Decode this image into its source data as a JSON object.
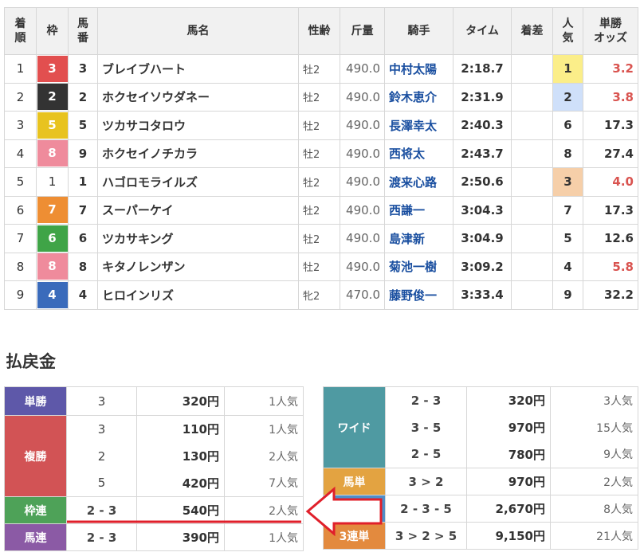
{
  "results": {
    "headers": [
      "着順",
      "枠",
      "馬番",
      "馬名",
      "性齢",
      "斤量",
      "騎手",
      "タイム",
      "着差",
      "人気",
      "単勝オッズ"
    ],
    "header_lines": [
      [
        "着",
        "順"
      ],
      [
        "枠"
      ],
      [
        "馬",
        "番"
      ],
      [
        "馬名"
      ],
      [
        "性齢"
      ],
      [
        "斤量"
      ],
      [
        "騎手"
      ],
      [
        "タイム"
      ],
      [
        "着差"
      ],
      [
        "人",
        "気"
      ],
      [
        "単勝",
        "オッズ"
      ]
    ],
    "rows": [
      {
        "rank": "1",
        "waku": "3",
        "waku_color": "#e24f4f",
        "umaban": "3",
        "name": "ブレイブハート",
        "sexage": "牡2",
        "weight": "490.0",
        "jockey": "中村太陽",
        "time": "2:18.7",
        "margin": "",
        "pop": "1",
        "odds": "3.2"
      },
      {
        "rank": "2",
        "waku": "2",
        "waku_color": "#333333",
        "umaban": "2",
        "name": "ホクセイソウダネー",
        "sexage": "牡2",
        "weight": "490.0",
        "jockey": "鈴木恵介",
        "time": "2:31.9",
        "margin": "",
        "pop": "2",
        "odds": "3.8"
      },
      {
        "rank": "3",
        "waku": "5",
        "waku_color": "#e8c31f",
        "umaban": "5",
        "name": "ツカサコタロウ",
        "sexage": "牡2",
        "weight": "490.0",
        "jockey": "長澤幸太",
        "time": "2:40.3",
        "margin": "",
        "pop": "6",
        "odds": "17.3"
      },
      {
        "rank": "4",
        "waku": "8",
        "waku_color": "#ef8b9c",
        "umaban": "9",
        "name": "ホクセイノチカラ",
        "sexage": "牡2",
        "weight": "490.0",
        "jockey": "西将太",
        "time": "2:43.7",
        "margin": "",
        "pop": "8",
        "odds": "27.4"
      },
      {
        "rank": "5",
        "waku": "1",
        "waku_color": "#ffffff",
        "umaban": "1",
        "name": "ハゴロモライルズ",
        "sexage": "牡2",
        "weight": "490.0",
        "jockey": "渡来心路",
        "time": "2:50.6",
        "margin": "",
        "pop": "3",
        "odds": "4.0"
      },
      {
        "rank": "6",
        "waku": "7",
        "waku_color": "#ee8e33",
        "umaban": "7",
        "name": "スーパーケイ",
        "sexage": "牡2",
        "weight": "490.0",
        "jockey": "西謙一",
        "time": "3:04.3",
        "margin": "",
        "pop": "7",
        "odds": "17.3"
      },
      {
        "rank": "7",
        "waku": "6",
        "waku_color": "#3fa447",
        "umaban": "6",
        "name": "ツカサキング",
        "sexage": "牡2",
        "weight": "490.0",
        "jockey": "島津新",
        "time": "3:04.9",
        "margin": "",
        "pop": "5",
        "odds": "12.6"
      },
      {
        "rank": "8",
        "waku": "8",
        "waku_color": "#ef8b9c",
        "umaban": "8",
        "name": "キタノレンザン",
        "sexage": "牡2",
        "weight": "490.0",
        "jockey": "菊池一樹",
        "time": "3:09.2",
        "margin": "",
        "pop": "4",
        "odds": "5.8"
      },
      {
        "rank": "9",
        "waku": "4",
        "waku_color": "#3a6bbb",
        "umaban": "4",
        "name": "ヒロインリズ",
        "sexage": "牝2",
        "weight": "470.0",
        "jockey": "藤野俊一",
        "time": "3:33.4",
        "margin": "",
        "pop": "9",
        "odds": "32.2"
      }
    ]
  },
  "payout": {
    "heading": "払戻金",
    "left": {
      "tansho": {
        "label": "単勝",
        "combo": "3",
        "yen": "320円",
        "pop": "1人気"
      },
      "fukusho": {
        "label": "複勝",
        "rows": [
          {
            "combo": "3",
            "yen": "110円",
            "pop": "1人気"
          },
          {
            "combo": "2",
            "yen": "130円",
            "pop": "2人気"
          },
          {
            "combo": "5",
            "yen": "420円",
            "pop": "7人気"
          }
        ]
      },
      "wakuren": {
        "label": "枠連",
        "combo": "2 - 3",
        "yen": "540円",
        "pop": "2人気"
      },
      "umaren": {
        "label": "馬連",
        "combo": "2 - 3",
        "yen": "390円",
        "pop": "1人気"
      }
    },
    "right": {
      "wide": {
        "label": "ワイド",
        "rows": [
          {
            "combo": "2 - 3",
            "yen": "320円",
            "pop": "3人気"
          },
          {
            "combo": "3 - 5",
            "yen": "970円",
            "pop": "15人気"
          },
          {
            "combo": "2 - 5",
            "yen": "780円",
            "pop": "9人気"
          }
        ]
      },
      "umatan": {
        "label": "馬単",
        "combo": "3 > 2",
        "yen": "970円",
        "pop": "2人気"
      },
      "sanrenpuku": {
        "label": "",
        "combo": "2 - 3 - 5",
        "yen": "2,670円",
        "pop": "8人気"
      },
      "sanrentan": {
        "label": "3連単",
        "combo": "3 > 2 > 5",
        "yen": "9,150円",
        "pop": "21人気"
      }
    }
  },
  "colors": {
    "arrow": "#e01f2a",
    "red_odds": "#d9534f"
  }
}
